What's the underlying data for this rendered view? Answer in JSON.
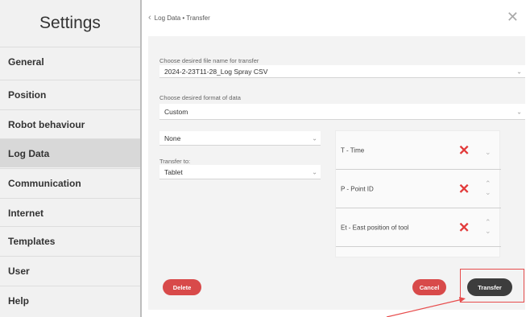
{
  "sidebar": {
    "title": "Settings",
    "items": [
      {
        "label": "General",
        "active": false
      },
      {
        "label": "Position",
        "active": false
      },
      {
        "label": "Robot behaviour",
        "active": false
      },
      {
        "label": "Log Data",
        "active": true
      },
      {
        "label": "Communication",
        "active": false
      },
      {
        "label": "Internet",
        "active": false
      },
      {
        "label": "Templates",
        "active": false
      },
      {
        "label": "User",
        "active": false
      },
      {
        "label": "Help",
        "active": false
      }
    ]
  },
  "header": {
    "breadcrumb": "Log Data • Transfer",
    "back_icon": "chevron-left-icon",
    "close_icon": "close-icon"
  },
  "form": {
    "filename_label": "Choose desired file name for transfer",
    "filename_value": "2024-2-23T11-28_Log Spray CSV",
    "format_label": "Choose desired format of data",
    "format_value": "Custom",
    "none_value": "None",
    "transfer_to_label": "Transfer to:",
    "transfer_to_value": "Tablet"
  },
  "columns": [
    {
      "label": "T - Time",
      "has_up": false,
      "has_down": true
    },
    {
      "label": "P - Point ID",
      "has_up": true,
      "has_down": true
    },
    {
      "label": "Et - East position of tool",
      "has_up": true,
      "has_down": true
    }
  ],
  "buttons": {
    "delete": "Delete",
    "cancel": "Cancel",
    "transfer": "Transfer"
  },
  "colors": {
    "accent_red": "#d84a4a",
    "remove_red": "#e23a3a",
    "dark_button": "#3d3d3d",
    "annotation_red": "#e74c4c"
  }
}
